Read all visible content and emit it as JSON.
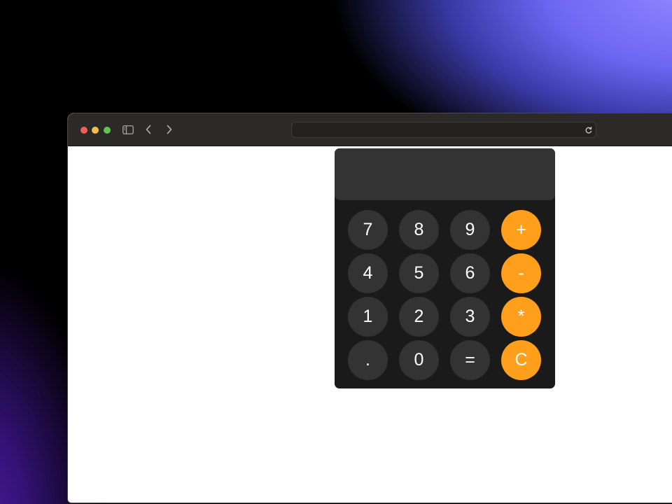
{
  "browser": {
    "address_value": ""
  },
  "calculator": {
    "display_value": "",
    "keys": [
      {
        "label": "7",
        "type": "digit"
      },
      {
        "label": "8",
        "type": "digit"
      },
      {
        "label": "9",
        "type": "digit"
      },
      {
        "label": "+",
        "type": "operator"
      },
      {
        "label": "4",
        "type": "digit"
      },
      {
        "label": "5",
        "type": "digit"
      },
      {
        "label": "6",
        "type": "digit"
      },
      {
        "label": "-",
        "type": "operator"
      },
      {
        "label": "1",
        "type": "digit"
      },
      {
        "label": "2",
        "type": "digit"
      },
      {
        "label": "3",
        "type": "digit"
      },
      {
        "label": "*",
        "type": "operator"
      },
      {
        "label": ".",
        "type": "digit"
      },
      {
        "label": "0",
        "type": "digit"
      },
      {
        "label": "=",
        "type": "digit"
      },
      {
        "label": "C",
        "type": "operator"
      }
    ]
  },
  "colors": {
    "key_background": "#333333",
    "operator_key": "#ff9f1c",
    "calculator_body": "#1a1a1a",
    "toolbar": "#2b2a29"
  },
  "icons": {
    "sidebar_toggle": "sidebar-icon",
    "back": "chevron-left-icon",
    "forward": "chevron-right-icon",
    "reload": "reload-icon"
  }
}
